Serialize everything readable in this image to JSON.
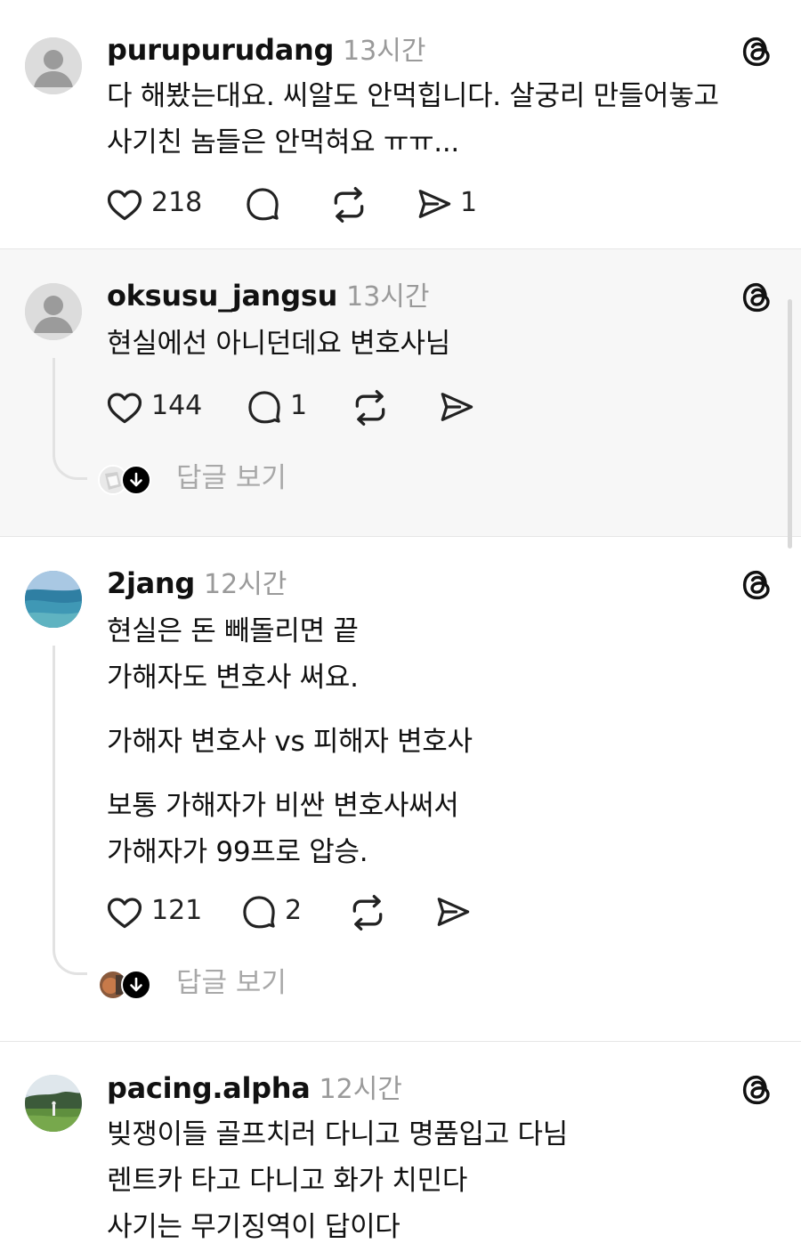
{
  "posts": [
    {
      "username": "purupurudang",
      "time": "13시간",
      "lines": [
        "다 해봤는대요. 씨알도 안먹힙니다. 살궁리 만들어놓고",
        "사기친 놈들은 안먹혀요 ㅠㅠ..."
      ],
      "likes": "218",
      "comments": "",
      "shares": "1"
    },
    {
      "username": "oksusu_jangsu",
      "time": "13시간",
      "lines": [
        "현실에선 아니던데요 변호사님"
      ],
      "likes": "144",
      "comments": "1",
      "shares": "",
      "view_replies": "답글 보기"
    },
    {
      "username": "2jang",
      "time": "12시간",
      "para1": [
        "현실은 돈 빼돌리면 끝",
        "가해자도 변호사 써요."
      ],
      "para2": [
        "가해자 변호사 vs 피해자 변호사"
      ],
      "para3": [
        "보통 가해자가 비싼 변호사써서",
        "가해자가 99프로 압승."
      ],
      "likes": "121",
      "comments": "2",
      "shares": "",
      "view_replies": "답글 보기"
    },
    {
      "username": "pacing.alpha",
      "time": "12시간",
      "lines": [
        "빚쟁이들 골프치러 다니고 명품입고 다님",
        "렌트카 타고 다니고 화가 치민다",
        "사기는 무기징역이 답이다"
      ]
    }
  ],
  "icons": {
    "like": "heart-icon",
    "comment": "comment-bubble-icon",
    "repost": "repost-icon",
    "share": "send-icon",
    "brand": "threads-logo-icon",
    "expand": "arrow-down-icon"
  },
  "colors": {
    "text": "#111111",
    "muted": "#9a9a9a",
    "divider": "#e6e6e6",
    "highlight_bg": "#f7f7f7"
  }
}
